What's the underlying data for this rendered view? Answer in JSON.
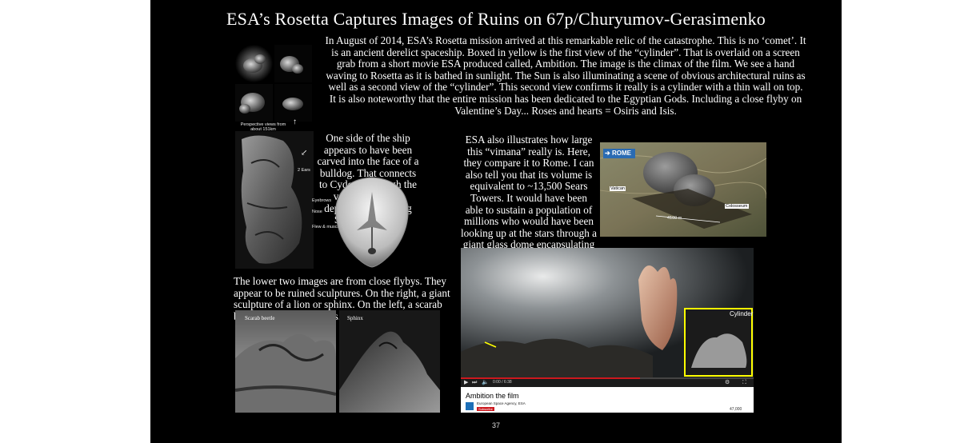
{
  "title": "ESA’s Rosetta Captures Images of Ruins on 67p/Churyumov-Gerasimenko",
  "intro_text": "In August of 2014, ESA’s Rosetta mission arrived at this remarkable relic of the catastrophe. This is no ‘comet’. It is an ancient derelict spaceship. Boxed in yellow is the first view of the “cylinder”. That is overlaid on a screen grab from a short movie ESA produced called, Ambition. The image is the climax of the film. We see a hand waving to Rosetta as it is bathed in sunlight. The Sun is also illuminating a scene of obvious architectural ruins as well as a second view of the “cylinder”. This second view confirms it really is a cylinder with a thin wall on top. It is also noteworthy that the entire mission has been dedicated to the Egyptian Gods. Including a close flyby on Valentine’s Day... Roses and hearts = Osiris and Isis.",
  "bulldog_text": "One side of the ship appears to have been carved into the face of a bulldog. That connects to Cydonia through the very same breed depicted in the “Dog Star” reflection.",
  "scale_text": "ESA also illustrates how large this “vimana” really is. Here, they compare it to Rome. I can also tell you that its volume is equivalent to ~13,500 Sears Towers. It would have been able to sustain a population of millions who would have been looking up at the stars through a giant glass dome encapsulating this gigantic interstellar space ship.",
  "lower_text": "The lower two images are from close flybys. They appear to be ruined sculptures. On the right, a giant sculpture of a lion or sphinx. On the left, a scarab beetle with serrated jaws.",
  "comet_grid_caption": "Perspective views from about 151km",
  "bulldog_labels": {
    "ears": "2 Ears",
    "eyebrows": "Eyebrows",
    "nose": "Nose",
    "flew": "Flew & muscle"
  },
  "rome_labels": {
    "rome": "ROME",
    "vatican": "Vatican",
    "colosseum": "Colosseum",
    "distance": "4100 m"
  },
  "flyby_labels": {
    "scarab": "Scarab beetle",
    "sphinx": "Sphinx"
  },
  "cylinder_label": "Cylinder",
  "video": {
    "title": "Ambition the film",
    "channel": "European Space Agency, ESA",
    "subscribe": "Subscribe",
    "time": "0:00 / 6:38",
    "views": "47,000"
  },
  "page_number": "37",
  "colors": {
    "highlight": "#ffff00",
    "youtube_red": "#cc181e",
    "page_bg": "#000000"
  }
}
